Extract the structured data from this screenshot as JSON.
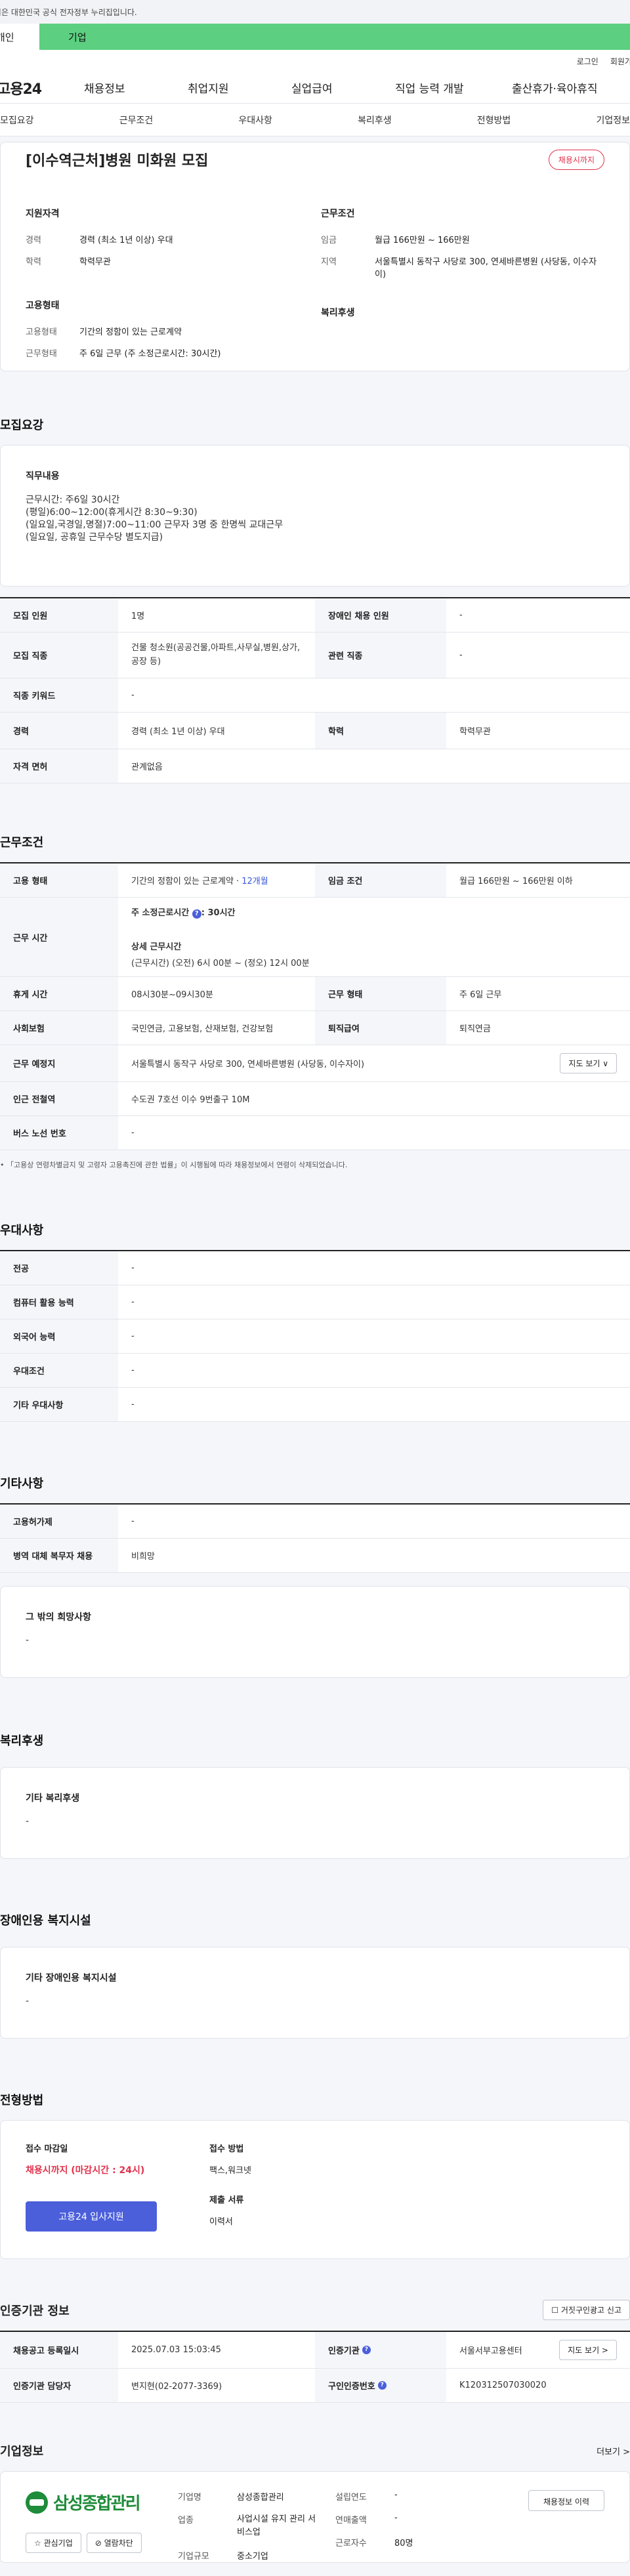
{
  "gov_notice": "이 누리집은 대한민국 공식 전자정부 누리집입니다.",
  "user_tabs": [
    "개인",
    "기업"
  ],
  "header_links": [
    "로그인",
    "회원가입"
  ],
  "logo": "고용24",
  "gnb": [
    "채용정보",
    "취업지원",
    "실업급여",
    "직업 능력 개발",
    "출산휴가·육아휴직"
  ],
  "snb": [
    "모집요강",
    "근무조건",
    "우대사항",
    "복리후생",
    "전형방법",
    "기업정보"
  ],
  "summary": {
    "title": "[이수역근처]병원 미화원 모집",
    "status_badge": "채용시까지",
    "qual_title": "지원자격",
    "qual_rows": [
      {
        "k": "경력",
        "v": "경력 (최소 1년 이상) 우대"
      },
      {
        "k": "학력",
        "v": "학력무관"
      }
    ],
    "work_title": "근무조건",
    "work_rows": [
      {
        "k": "임금",
        "v": "월급 166만원 ~ 166만원"
      },
      {
        "k": "지역",
        "v": "서울특별시 동작구 사당로 300, 연세바른병원 (사당동, 이수자이)"
      }
    ],
    "emp_title": "고용형태",
    "emp_rows": [
      {
        "k": "고용형태",
        "v": "기간의 정함이 있는 근로계약"
      },
      {
        "k": "근무형태",
        "v": "주 6일 근무 (주 소정근로시간: 30시간)"
      }
    ],
    "welfare_title": "복리후생"
  },
  "recruit": {
    "section_title": "모집요강",
    "duty_label": "직무내용",
    "duty_text": "근무시간: 주6일 30시간\n(평일)6:00~12:00(휴게시간 8:30~9:30)\n(일요일,국경일,명절)7:00~11:00 근무자 3명 중 한명씩 교대근무\n(일요일, 공휴일 근무수당 별도지급)",
    "rows": [
      {
        "k1": "모집 인원",
        "v1": "1명",
        "k2": "장애인 채용 인원",
        "v2": "-"
      },
      {
        "k1": "모집 직종",
        "v1": "건물 청소원(공공건물,아파트,사무실,병원,상가,공장 등)",
        "k2": "관련 직종",
        "v2": "-"
      }
    ],
    "full_rows": [
      {
        "k": "직종 키워드",
        "v": "-"
      }
    ],
    "rows2": [
      {
        "k1": "경력",
        "v1": "경력 (최소 1년 이상) 우대",
        "k2": "학력",
        "v2": "학력무관"
      }
    ],
    "full_rows2": [
      {
        "k": "자격 면허",
        "v": "관계없음"
      }
    ]
  },
  "work": {
    "section_title": "근무조건",
    "employ_type_label": "고용 형태",
    "employ_type": "기간의 정함이 있는 근로계약 · ",
    "employ_months": "12개월",
    "wage_label": "임금 조건",
    "wage": "월급 166만원 ~ 166만원 이하",
    "hours_label": "근무 시간",
    "hours_week_label": "주 소정근로시간",
    "hours_week": ": 30시간",
    "hours_detail_label": "상세 근무시간",
    "hours_detail": "(근무시간) (오전) 6시 00분 ~ (정오) 12시 00분",
    "rows": [
      {
        "k1": "휴게 시간",
        "v1": "08시30분~09시30분",
        "k2": "근무 형태",
        "v2": "주 6일 근무"
      },
      {
        "k1": "사회보험",
        "v1": "국민연금, 고용보험, 산재보험, 건강보험",
        "k2": "퇴직급여",
        "v2": "퇴직연금"
      }
    ],
    "place_label": "근무 예정지",
    "place": "서울특별시 동작구 사당로 300, 연세바른병원 (사당동, 이수자이)",
    "map_btn": "지도 보기 ∨",
    "subway_label": "인근 전철역",
    "subway": "수도권 7호선 이수 9번출구 10M",
    "bus_label": "버스 노선 번호",
    "bus": "-",
    "note": "「고용상 연령차별금지 및 고령자 고용촉진에 관한 법률」이 시행됨에 따라 채용정보에서 연령이 삭제되었습니다."
  },
  "pref": {
    "section_title": "우대사항",
    "rows": [
      {
        "k": "전공",
        "v": "-"
      },
      {
        "k": "컴퓨터 활용 능력",
        "v": "-"
      },
      {
        "k": "외국어 능력",
        "v": "-"
      },
      {
        "k": "우대조건",
        "v": "-"
      },
      {
        "k": "기타 우대사항",
        "v": "-"
      }
    ]
  },
  "etc": {
    "section_title": "기타사항",
    "rows": [
      {
        "k": "고용허가제",
        "v": "-"
      },
      {
        "k": "병역 대체 복무자 채용",
        "v": "비희망"
      }
    ],
    "card_label": "그 밖의 희망사항",
    "card_value": "-"
  },
  "welfare": {
    "section_title": "복리후생",
    "card_label": "기타 복리후생",
    "card_value": "-"
  },
  "disabled": {
    "section_title": "장애인용 복지시설",
    "card_label": "기타 장애인용 복지시설",
    "card_value": "-"
  },
  "process": {
    "section_title": "전형방법",
    "deadline_label": "접수 마감일",
    "deadline": "채용시까지 (마감시간 : 24시)",
    "apply_btn": "고용24 입사지원",
    "method_label": "접수 방법",
    "method": "팩스,워크넷",
    "docs_label": "제출 서류",
    "docs": "이력서"
  },
  "agency": {
    "section_title": "인증기관 정보",
    "report_btn": "거짓구인광고 신고",
    "rows": [
      {
        "k1": "채용공고 등록일시",
        "v1": "2025.07.03 15:03:45",
        "k2": "인증기관",
        "v2": "서울서부고용센터"
      },
      {
        "k1": "인증기관 담당자",
        "v1": "변지현(02-2077-3369)",
        "k2": "구인인증번호",
        "v2": "K120312507030020"
      }
    ],
    "map_btn": "지도 보기 >"
  },
  "company": {
    "section_title": "기업정보",
    "more": "더보기 >",
    "name": "삼성종합관리",
    "fav_btn": "☆ 관심기업",
    "block_btn": "⊘ 열람차단",
    "fields": [
      {
        "k": "기업명",
        "v": "삼성종합관리"
      },
      {
        "k": "업종",
        "v": "사업시설 유지 관리 서비스업"
      },
      {
        "k": "기업규모",
        "v": "중소기업"
      }
    ],
    "fields2": [
      {
        "k": "설립연도",
        "v": "-"
      },
      {
        "k": "연매출액",
        "v": "-"
      },
      {
        "k": "근로자수",
        "v": "80명"
      }
    ],
    "history_btn": "채용정보 이력"
  },
  "colors": {
    "accent": "#5ccf80",
    "brand_blue": "#4b5fdb",
    "danger": "#e0314b",
    "link_blue": "#3a57d6"
  }
}
